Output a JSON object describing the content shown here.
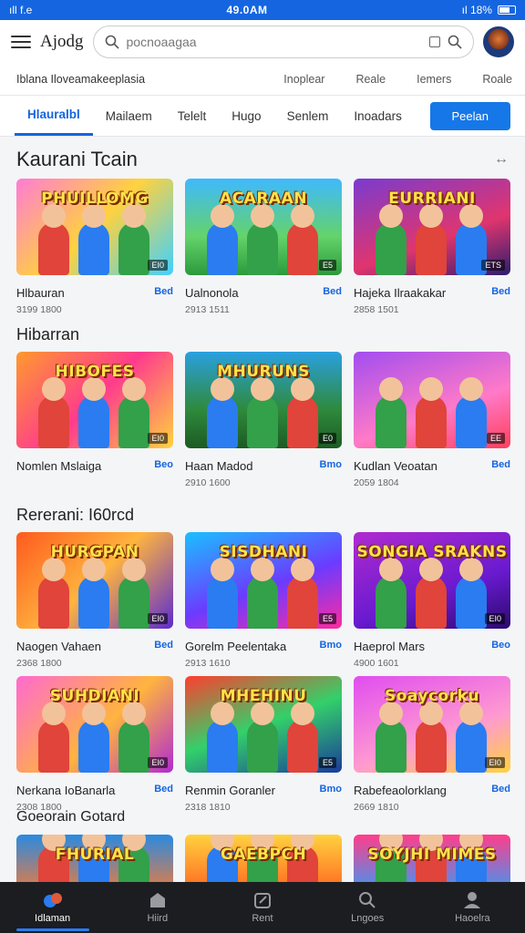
{
  "status": {
    "left": "ıll  f.e",
    "time": "49.0AM",
    "right": "ıl 18%"
  },
  "topbar": {
    "logo": "Ajodg",
    "search_placeholder": "pocnoaagaa"
  },
  "subbar": {
    "title": "Iblana Iloveamakeeplasia",
    "links": [
      "Inoplear",
      "Reale",
      "Iemers",
      "Roale"
    ]
  },
  "tabs": {
    "items": [
      "Hlauralbl",
      "Mailaem",
      "Telelt",
      "Hugo",
      "Senlem",
      "Inoadars"
    ],
    "button": "Peelan"
  },
  "sections": [
    {
      "title": "Kaurani Tcain",
      "action": "↔",
      "cards": [
        {
          "art": "PHUILLOMG",
          "chip": "EI0",
          "title": "Hlbauran",
          "badge": "Bed",
          "sub": "3199 1800",
          "bg": "linear-gradient(135deg,#ff7bd4,#ffd23e 50%,#3fd1ff)"
        },
        {
          "art": "ACARAAN",
          "chip": "E5",
          "title": "Ualnonola",
          "badge": "Bed",
          "sub": "2913 1511",
          "bg": "linear-gradient(180deg,#3fb9ff,#64d36a 60%,#2b9a3c)"
        },
        {
          "art": "EURRIANI",
          "chip": "ETS",
          "title": "Hajeka Ilraakakar",
          "badge": "Bed",
          "sub": "2858 1501",
          "bg": "linear-gradient(160deg,#7a3bd0,#e0356e 60%,#2a1d6e)"
        }
      ]
    },
    {
      "title": "Hibarran",
      "action": "",
      "cards": [
        {
          "art": "HIBOFES",
          "chip": "EI0",
          "title": "Nomlen Mslaiga",
          "badge": "Beo",
          "sub": "",
          "bg": "linear-gradient(135deg,#ff9a2e,#ff3b8d 50%,#ffd23e)"
        },
        {
          "art": "MHURUNS",
          "chip": "E0",
          "title": "Haan Madod",
          "badge": "Bmo",
          "sub": "2910 1600",
          "bg": "linear-gradient(180deg,#2aa0e0,#2e8a3c 60%,#1d5a24)"
        },
        {
          "art": "",
          "chip": "EE",
          "title": "Kudlan Veoatan",
          "badge": "Bed",
          "sub": "2059 1804",
          "bg": "linear-gradient(160deg,#a24df0,#ff7ac8 60%,#ff3e5a)"
        }
      ]
    },
    {
      "title": "Rererani: I60rcd",
      "action": "",
      "cards": [
        {
          "art": "HURGPAN",
          "chip": "EI0",
          "title": "Naogen Vahaen",
          "badge": "Bed",
          "sub": "2368 1800",
          "bg": "linear-gradient(135deg,#ff5a1e,#ffb43e 50%,#5b2bd0)"
        },
        {
          "art": "SISDHANI",
          "chip": "E5",
          "title": "Gorelm Peelentaka",
          "badge": "Bmo",
          "sub": "2913 1610",
          "bg": "linear-gradient(160deg,#1ac0ff,#6b3bff 55%,#ff2ba0)"
        },
        {
          "art": "SONGIA SRAKNS",
          "chip": "EI0",
          "title": "Haeprol Mars",
          "badge": "Beo",
          "sub": "4900 1601",
          "bg": "linear-gradient(160deg,#b02bd0,#6a1ad0 60%,#2a0a6e)"
        }
      ]
    },
    {
      "title": "",
      "action": "",
      "cards": [
        {
          "art": "SUHDIANI",
          "chip": "EI0",
          "title": "Nerkana IoBanarla",
          "badge": "Bed",
          "sub": "2308 1800",
          "bg": "linear-gradient(135deg,#ff6ad0,#ffb43e 55%,#b02bd0)"
        },
        {
          "art": "MHEHINU",
          "chip": "E5",
          "title": "Renmin Goranler",
          "badge": "Bmo",
          "sub": "2318 1810",
          "bg": "linear-gradient(160deg,#ff3e2e,#33d06a 50%,#1a3a9a)"
        },
        {
          "art": "Soaycorku",
          "chip": "EI0",
          "title": "Rabefeaolorklang",
          "badge": "Bed",
          "sub": "2669 1810",
          "bg": "linear-gradient(160deg,#e04df0,#ff9ad0 60%,#ffd23e)"
        }
      ]
    },
    {
      "title": "Goeorain Gotard",
      "action": "",
      "cards": [
        {
          "art": "FHURIAL",
          "chip": "",
          "title": "",
          "badge": "",
          "sub": "",
          "bg": "linear-gradient(180deg,#2a8ae0,#ff7a2e)"
        },
        {
          "art": "GAEBPCH",
          "chip": "",
          "title": "",
          "badge": "",
          "sub": "",
          "bg": "linear-gradient(180deg,#ffd23e,#ff5a1e)"
        },
        {
          "art": "SOYJHI MIMES",
          "chip": "",
          "title": "",
          "badge": "",
          "sub": "",
          "bg": "linear-gradient(180deg,#ff3e8a,#2aa0ff)"
        }
      ]
    }
  ],
  "bottomnav": {
    "items": [
      "Idlaman",
      "Hiird",
      "Rent",
      "Lngoes",
      "Haoelra"
    ],
    "active": 0
  },
  "colors": {
    "accent": "#1565e0",
    "nav_bg": "#1c1d20"
  }
}
